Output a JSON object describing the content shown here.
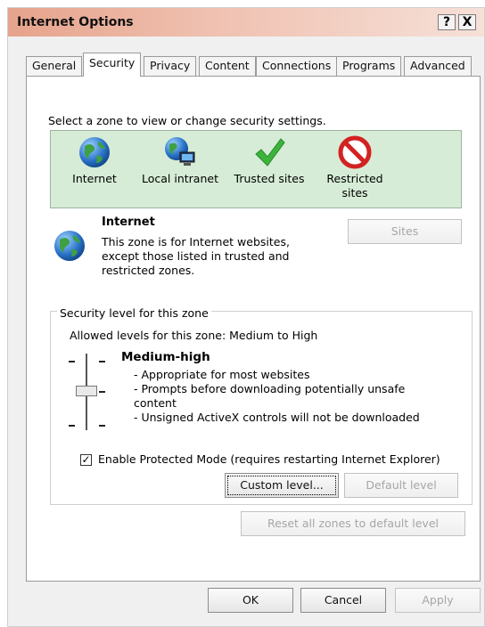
{
  "window": {
    "title": "Internet Options",
    "help_label": "?",
    "close_label": "X"
  },
  "tabs": [
    {
      "label": "General",
      "selected": false
    },
    {
      "label": "Security",
      "selected": true
    },
    {
      "label": "Privacy",
      "selected": false
    },
    {
      "label": "Content",
      "selected": false
    },
    {
      "label": "Connections",
      "selected": false
    },
    {
      "label": "Programs",
      "selected": false
    },
    {
      "label": "Advanced",
      "selected": false
    }
  ],
  "security": {
    "zone_prompt": "Select a zone to view or change security settings.",
    "zones": [
      {
        "label": "Internet",
        "icon": "globe-icon",
        "selected": true
      },
      {
        "label": "Local intranet",
        "icon": "intranet-icon",
        "selected": false
      },
      {
        "label": "Trusted sites",
        "icon": "checkmark-icon",
        "selected": false
      },
      {
        "label": "Restricted sites",
        "icon": "restricted-icon",
        "selected": false
      }
    ],
    "zone_info": {
      "title": "Internet",
      "description": "This zone is for Internet websites, except those listed in trusted and restricted zones."
    },
    "sites_button": "Sites",
    "level_group": {
      "legend": "Security level for this zone",
      "allowed": "Allowed levels for this zone: Medium to High",
      "level_name": "Medium-high",
      "bullets": [
        "- Appropriate for most websites",
        "- Prompts before downloading potentially unsafe content",
        "- Unsigned ActiveX controls will not be downloaded"
      ],
      "protected_mode_label": "Enable Protected Mode (requires restarting Internet Explorer)",
      "protected_mode_checked": true,
      "custom_level_button": "Custom level...",
      "default_level_button": "Default level"
    },
    "reset_all_button": "Reset all zones to default level"
  },
  "footer": {
    "ok": "OK",
    "cancel": "Cancel",
    "apply": "Apply"
  },
  "colors": {
    "zone_box_bg": "#d6ecd6",
    "title_gradient_start": "#e6a38c",
    "disabled_text": "#a6a6a6"
  }
}
